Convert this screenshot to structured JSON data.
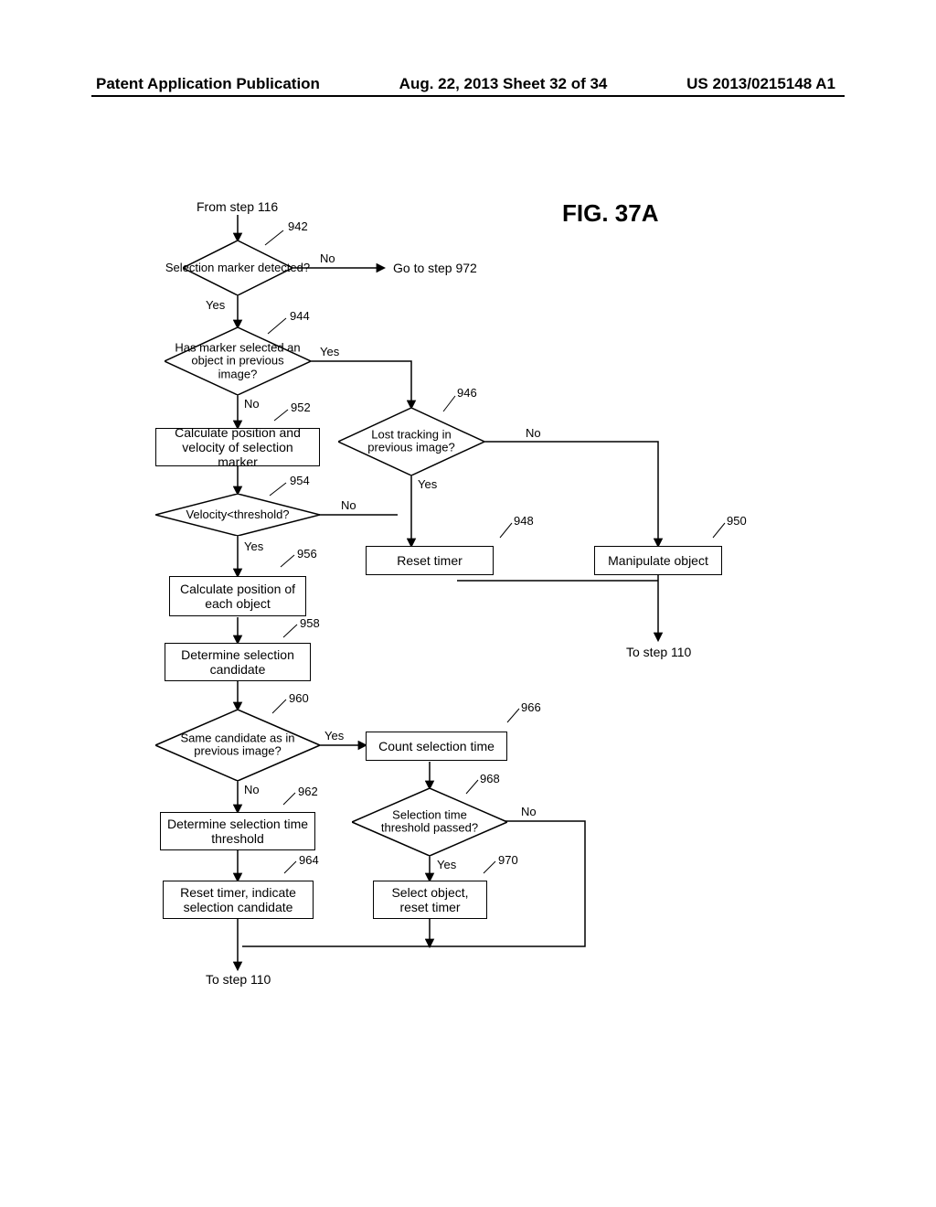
{
  "header": {
    "left": "Patent Application Publication",
    "center": "Aug. 22, 2013  Sheet 32 of 34",
    "right": "US 2013/0215148 A1"
  },
  "figure": {
    "title": "FIG. 37A"
  },
  "labels": {
    "from": "From step 116",
    "to_step_972": "Go to step 972",
    "to_110_a": "To step 110",
    "to_110_b": "To step 110",
    "yes": "Yes",
    "no": "No"
  },
  "nodes": {
    "d942": "Selection marker detected?",
    "d944": "Has marker selected an object in previous image?",
    "r952": "Calculate position and velocity of selection marker",
    "d946": "Lost tracking in previous image?",
    "d954": "Velocity<threshold?",
    "r948": "Reset timer",
    "r950": "Manipulate object",
    "r956": "Calculate position of each object",
    "r958": "Determine selection candidate",
    "d960": "Same candidate as in previous image?",
    "r966": "Count selection time",
    "r962": "Determine selection time threshold",
    "d968": "Selection time threshold passed?",
    "r964": "Reset timer, indicate selection candidate",
    "r970": "Select object, reset timer"
  },
  "refs": {
    "n942": "942",
    "n944": "944",
    "n946": "946",
    "n948": "948",
    "n950": "950",
    "n952": "952",
    "n954": "954",
    "n956": "956",
    "n958": "958",
    "n960": "960",
    "n962": "962",
    "n964": "964",
    "n966": "966",
    "n968": "968",
    "n970": "970"
  }
}
